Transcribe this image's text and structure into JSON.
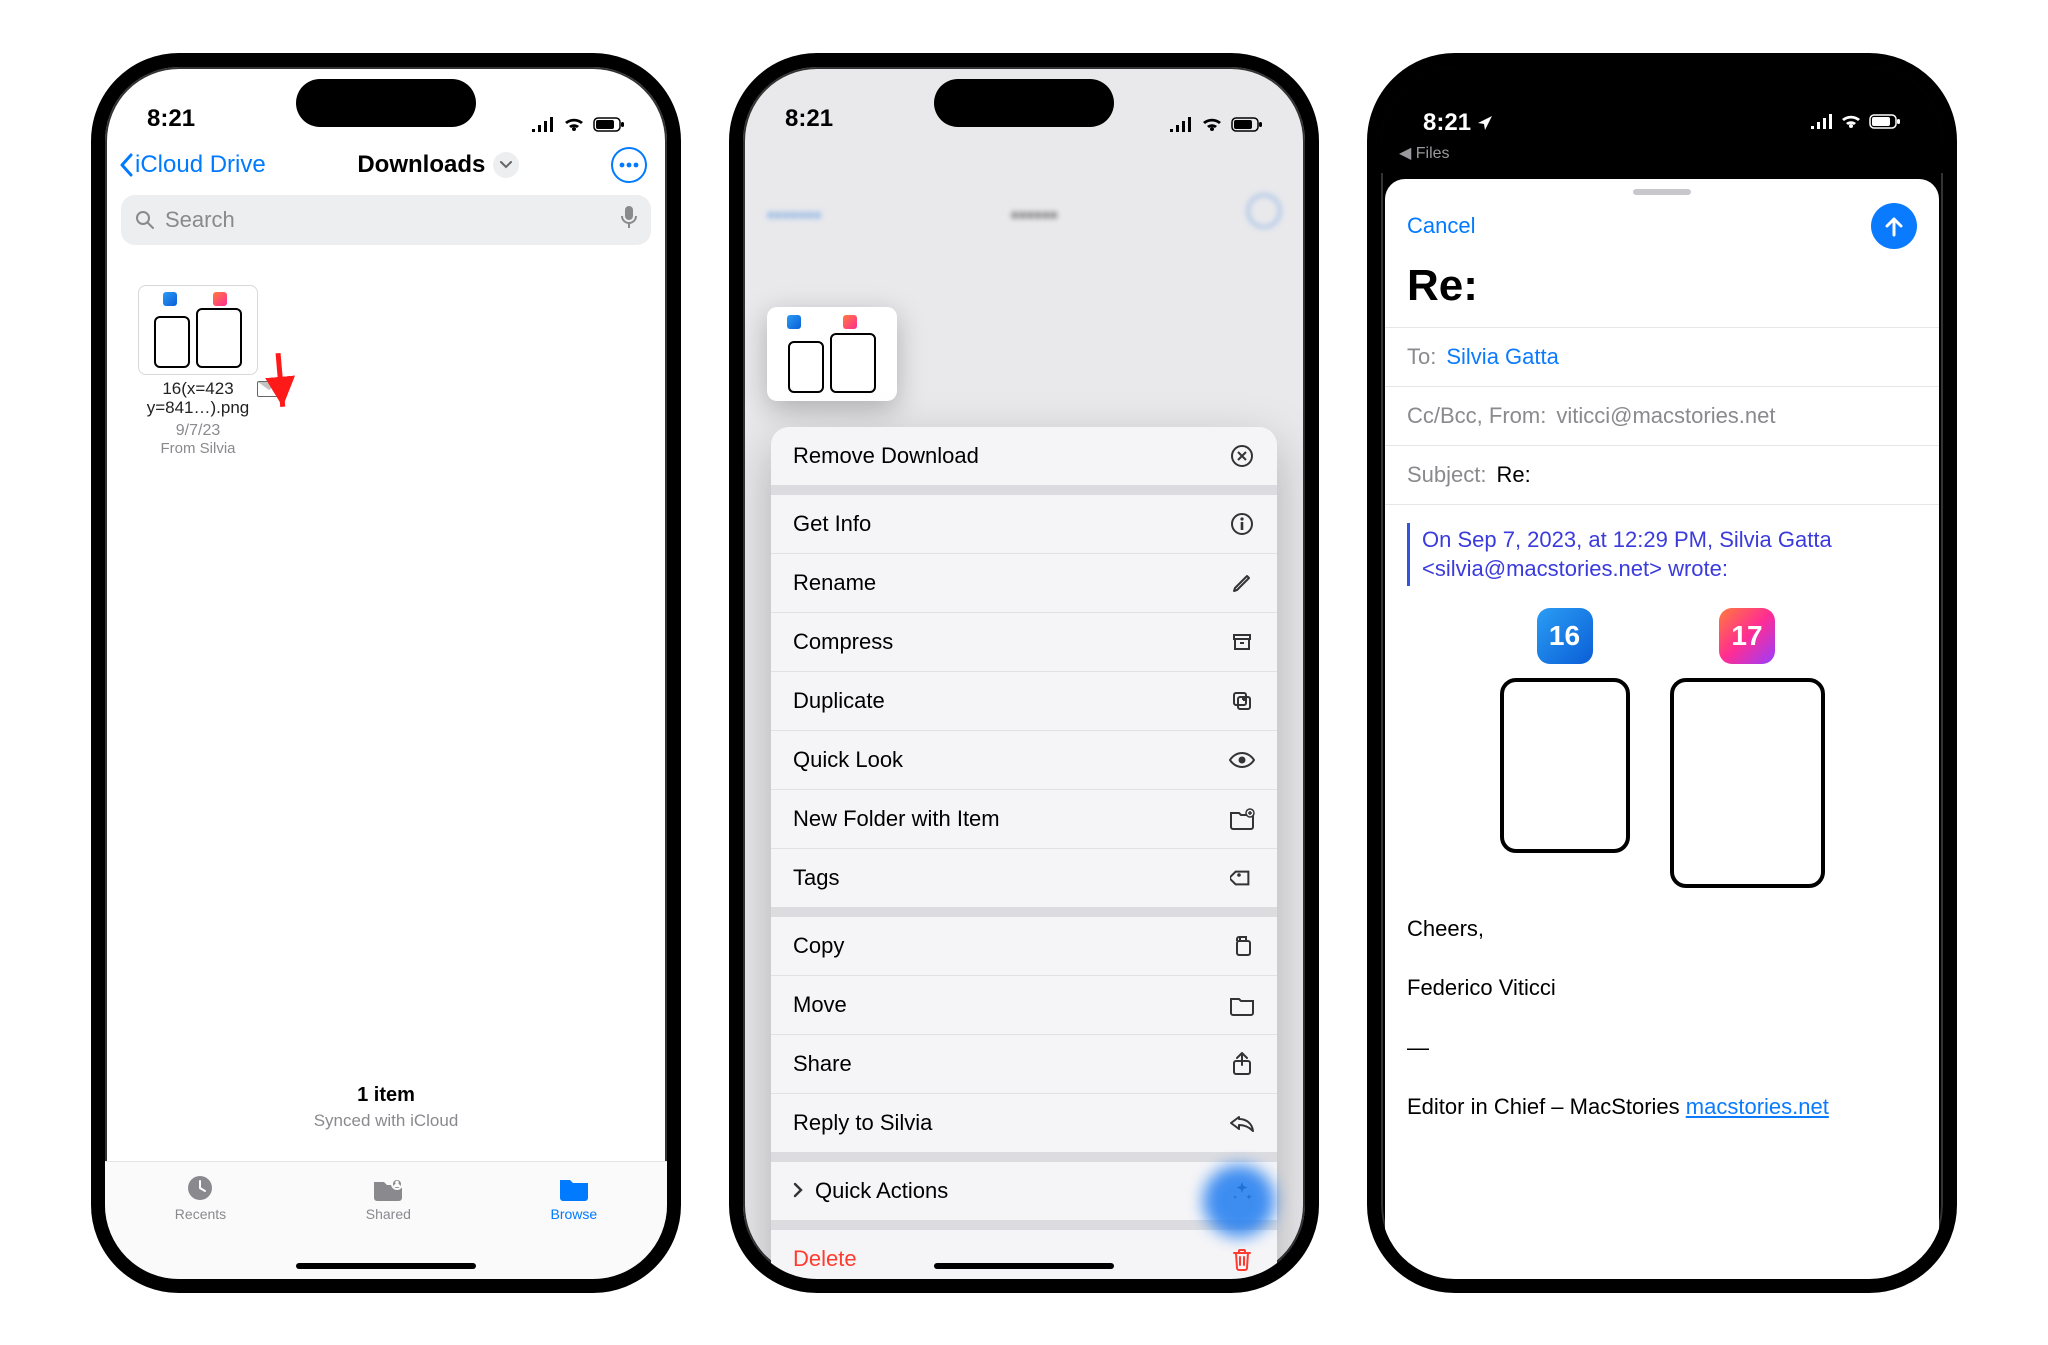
{
  "status": {
    "time": "8:21"
  },
  "files": {
    "back_label": "iCloud Drive",
    "title": "Downloads",
    "search_placeholder": "Search",
    "file": {
      "name_l1": "16(x=423",
      "name_l2": "y=841…).png",
      "date": "9/7/23",
      "from": "From Silvia"
    },
    "footer_count": "1 item",
    "footer_sync": "Synced with iCloud",
    "tabs": {
      "recents": "Recents",
      "shared": "Shared",
      "browse": "Browse"
    }
  },
  "context_menu": {
    "items_a": [
      {
        "label": "Remove Download",
        "icon": "x-circle"
      }
    ],
    "items_b": [
      {
        "label": "Get Info",
        "icon": "info"
      },
      {
        "label": "Rename",
        "icon": "pencil"
      },
      {
        "label": "Compress",
        "icon": "archive"
      },
      {
        "label": "Duplicate",
        "icon": "duplicate"
      },
      {
        "label": "Quick Look",
        "icon": "eye"
      },
      {
        "label": "New Folder with Item",
        "icon": "folder-plus"
      },
      {
        "label": "Tags",
        "icon": "tag"
      }
    ],
    "items_c": [
      {
        "label": "Copy",
        "icon": "copy"
      },
      {
        "label": "Move",
        "icon": "folder"
      },
      {
        "label": "Share",
        "icon": "share"
      },
      {
        "label": "Reply to Silvia",
        "icon": "reply"
      }
    ],
    "items_d": [
      {
        "label": "Quick Actions",
        "icon": "sparkle",
        "caret": true
      }
    ],
    "items_e": [
      {
        "label": "Delete",
        "icon": "trash",
        "danger": true
      }
    ]
  },
  "mail": {
    "breadcrumb": "Files",
    "cancel": "Cancel",
    "subject_big": "Re:",
    "to_label": "To:",
    "to_value": "Silvia Gatta",
    "cc_label": "Cc/Bcc, From:",
    "cc_value": "viticci@macstories.net",
    "subject_label": "Subject:",
    "subject_value": "Re:",
    "quote_l1": "On Sep 7, 2023, at 12:29 PM, Silvia Gatta",
    "quote_l2": "<silvia@macstories.net> wrote:",
    "os16": "16",
    "os17": "17",
    "sig_cheers": "Cheers,",
    "sig_name": "Federico Viticci",
    "sig_dash": "—",
    "sig_role": "Editor in Chief – MacStories ",
    "sig_link": "macstories.net"
  }
}
